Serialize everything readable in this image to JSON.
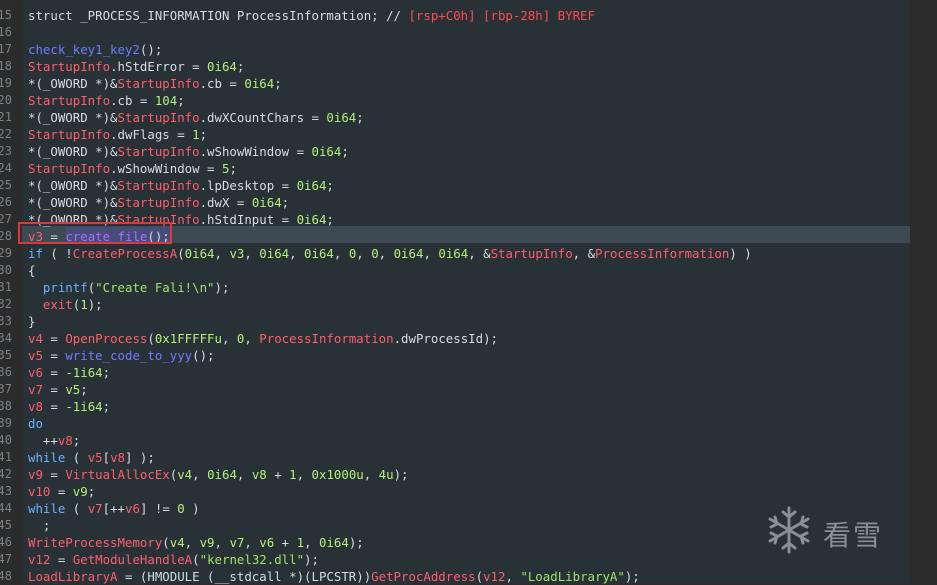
{
  "editor": {
    "lines": [
      {
        "n": "15",
        "tokens": [
          {
            "t": "struct _PROCESS_INFORMATION ProcessInformation; // ",
            "c": "plain"
          },
          {
            "t": "[rsp+C0h] [rbp-28h] BYREF",
            "c": "cmt"
          }
        ]
      },
      {
        "n": "16",
        "tokens": []
      },
      {
        "n": "17",
        "tokens": [
          {
            "t": "check_key1_key2",
            "c": "call"
          },
          {
            "t": "();",
            "c": "plain"
          }
        ]
      },
      {
        "n": "18",
        "tokens": [
          {
            "t": "StartupInfo",
            "c": "var"
          },
          {
            "t": ".hStdError = ",
            "c": "plain"
          },
          {
            "t": "0i64",
            "c": "num"
          },
          {
            "t": ";",
            "c": "plain"
          }
        ]
      },
      {
        "n": "19",
        "tokens": [
          {
            "t": "*(_OWORD *)&",
            "c": "plain"
          },
          {
            "t": "StartupInfo",
            "c": "var"
          },
          {
            "t": ".cb = ",
            "c": "plain"
          },
          {
            "t": "0i64",
            "c": "num"
          },
          {
            "t": ";",
            "c": "plain"
          }
        ]
      },
      {
        "n": "20",
        "tokens": [
          {
            "t": "StartupInfo",
            "c": "var"
          },
          {
            "t": ".cb = ",
            "c": "plain"
          },
          {
            "t": "104",
            "c": "num"
          },
          {
            "t": ";",
            "c": "plain"
          }
        ]
      },
      {
        "n": "21",
        "tokens": [
          {
            "t": "*(_OWORD *)&",
            "c": "plain"
          },
          {
            "t": "StartupInfo",
            "c": "var"
          },
          {
            "t": ".dwXCountChars = ",
            "c": "plain"
          },
          {
            "t": "0i64",
            "c": "num"
          },
          {
            "t": ";",
            "c": "plain"
          }
        ]
      },
      {
        "n": "22",
        "tokens": [
          {
            "t": "StartupInfo",
            "c": "var"
          },
          {
            "t": ".dwFlags = ",
            "c": "plain"
          },
          {
            "t": "1",
            "c": "num"
          },
          {
            "t": ";",
            "c": "plain"
          }
        ]
      },
      {
        "n": "23",
        "tokens": [
          {
            "t": "*(_OWORD *)&",
            "c": "plain"
          },
          {
            "t": "StartupInfo",
            "c": "var"
          },
          {
            "t": ".wShowWindow = ",
            "c": "plain"
          },
          {
            "t": "0i64",
            "c": "num"
          },
          {
            "t": ";",
            "c": "plain"
          }
        ]
      },
      {
        "n": "24",
        "tokens": [
          {
            "t": "StartupInfo",
            "c": "var"
          },
          {
            "t": ".wShowWindow = ",
            "c": "plain"
          },
          {
            "t": "5",
            "c": "num"
          },
          {
            "t": ";",
            "c": "plain"
          }
        ]
      },
      {
        "n": "25",
        "tokens": [
          {
            "t": "*(_OWORD *)&",
            "c": "plain"
          },
          {
            "t": "StartupInfo",
            "c": "var"
          },
          {
            "t": ".lpDesktop = ",
            "c": "plain"
          },
          {
            "t": "0i64",
            "c": "num"
          },
          {
            "t": ";",
            "c": "plain"
          }
        ]
      },
      {
        "n": "26",
        "tokens": [
          {
            "t": "*(_OWORD *)&",
            "c": "plain"
          },
          {
            "t": "StartupInfo",
            "c": "var"
          },
          {
            "t": ".dwX = ",
            "c": "plain"
          },
          {
            "t": "0i64",
            "c": "num"
          },
          {
            "t": ";",
            "c": "plain"
          }
        ]
      },
      {
        "n": "27",
        "tokens": [
          {
            "t": "*(_OWORD *)&",
            "c": "plain"
          },
          {
            "t": "StartupInfo",
            "c": "var"
          },
          {
            "t": ".hStdInput = ",
            "c": "plain"
          },
          {
            "t": "0i64",
            "c": "num"
          },
          {
            "t": ";",
            "c": "plain"
          }
        ]
      },
      {
        "n": "28",
        "tokens": [
          {
            "t": "v3",
            "c": "var"
          },
          {
            "t": " = ",
            "c": "plain"
          },
          {
            "t": "create_file",
            "c": "fn"
          },
          {
            "t": "();",
            "c": "plain"
          }
        ]
      },
      {
        "n": "29",
        "tokens": [
          {
            "t": "if",
            "c": "kw"
          },
          {
            "t": " ( !",
            "c": "plain"
          },
          {
            "t": "CreateProcessA",
            "c": "var"
          },
          {
            "t": "(",
            "c": "plain"
          },
          {
            "t": "0i64",
            "c": "num"
          },
          {
            "t": ", ",
            "c": "plain"
          },
          {
            "t": "v3",
            "c": "num"
          },
          {
            "t": ", ",
            "c": "plain"
          },
          {
            "t": "0i64",
            "c": "num"
          },
          {
            "t": ", ",
            "c": "plain"
          },
          {
            "t": "0i64",
            "c": "num"
          },
          {
            "t": ", ",
            "c": "plain"
          },
          {
            "t": "0",
            "c": "num"
          },
          {
            "t": ", ",
            "c": "plain"
          },
          {
            "t": "0",
            "c": "num"
          },
          {
            "t": ", ",
            "c": "plain"
          },
          {
            "t": "0i64",
            "c": "num"
          },
          {
            "t": ", ",
            "c": "plain"
          },
          {
            "t": "0i64",
            "c": "num"
          },
          {
            "t": ", &",
            "c": "plain"
          },
          {
            "t": "StartupInfo",
            "c": "var"
          },
          {
            "t": ", &",
            "c": "plain"
          },
          {
            "t": "ProcessInformation",
            "c": "var"
          },
          {
            "t": ") )",
            "c": "plain"
          }
        ]
      },
      {
        "n": "30",
        "tokens": [
          {
            "t": "{",
            "c": "plain"
          }
        ]
      },
      {
        "n": "31",
        "tokens": [
          {
            "t": "  ",
            "c": "plain"
          },
          {
            "t": "printf",
            "c": "kw"
          },
          {
            "t": "(",
            "c": "plain"
          },
          {
            "t": "\"Create Fali!\\n\"",
            "c": "str"
          },
          {
            "t": ");",
            "c": "plain"
          }
        ]
      },
      {
        "n": "32",
        "tokens": [
          {
            "t": "  ",
            "c": "plain"
          },
          {
            "t": "exit",
            "c": "var"
          },
          {
            "t": "(",
            "c": "plain"
          },
          {
            "t": "1",
            "c": "num"
          },
          {
            "t": ");",
            "c": "plain"
          }
        ]
      },
      {
        "n": "33",
        "tokens": [
          {
            "t": "}",
            "c": "plain"
          }
        ]
      },
      {
        "n": "34",
        "tokens": [
          {
            "t": "v4",
            "c": "var"
          },
          {
            "t": " = ",
            "c": "plain"
          },
          {
            "t": "OpenProcess",
            "c": "var"
          },
          {
            "t": "(",
            "c": "plain"
          },
          {
            "t": "0x1FFFFFu",
            "c": "num"
          },
          {
            "t": ", ",
            "c": "plain"
          },
          {
            "t": "0",
            "c": "num"
          },
          {
            "t": ", ",
            "c": "plain"
          },
          {
            "t": "ProcessInformation",
            "c": "var"
          },
          {
            "t": ".dwProcessId);",
            "c": "plain"
          }
        ]
      },
      {
        "n": "35",
        "tokens": [
          {
            "t": "v5",
            "c": "var"
          },
          {
            "t": " = ",
            "c": "plain"
          },
          {
            "t": "write_code_to_yyy",
            "c": "call"
          },
          {
            "t": "();",
            "c": "plain"
          }
        ]
      },
      {
        "n": "36",
        "tokens": [
          {
            "t": "v6",
            "c": "var"
          },
          {
            "t": " = ",
            "c": "plain"
          },
          {
            "t": "-1i64",
            "c": "num"
          },
          {
            "t": ";",
            "c": "plain"
          }
        ]
      },
      {
        "n": "37",
        "tokens": [
          {
            "t": "v7",
            "c": "var"
          },
          {
            "t": " = ",
            "c": "plain"
          },
          {
            "t": "v5",
            "c": "num"
          },
          {
            "t": ";",
            "c": "plain"
          }
        ]
      },
      {
        "n": "38",
        "tokens": [
          {
            "t": "v8",
            "c": "var"
          },
          {
            "t": " = ",
            "c": "plain"
          },
          {
            "t": "-1i64",
            "c": "num"
          },
          {
            "t": ";",
            "c": "plain"
          }
        ]
      },
      {
        "n": "39",
        "tokens": [
          {
            "t": "do",
            "c": "kw"
          }
        ]
      },
      {
        "n": "40",
        "tokens": [
          {
            "t": "  ++",
            "c": "plain"
          },
          {
            "t": "v8",
            "c": "var"
          },
          {
            "t": ";",
            "c": "plain"
          }
        ]
      },
      {
        "n": "41",
        "tokens": [
          {
            "t": "while",
            "c": "kw"
          },
          {
            "t": " ( ",
            "c": "plain"
          },
          {
            "t": "v5",
            "c": "var"
          },
          {
            "t": "[",
            "c": "plain"
          },
          {
            "t": "v8",
            "c": "var"
          },
          {
            "t": "] );",
            "c": "plain"
          }
        ]
      },
      {
        "n": "42",
        "tokens": [
          {
            "t": "v9",
            "c": "var"
          },
          {
            "t": " = ",
            "c": "plain"
          },
          {
            "t": "VirtualAllocEx",
            "c": "var"
          },
          {
            "t": "(",
            "c": "plain"
          },
          {
            "t": "v4",
            "c": "num"
          },
          {
            "t": ", ",
            "c": "plain"
          },
          {
            "t": "0i64",
            "c": "num"
          },
          {
            "t": ", ",
            "c": "plain"
          },
          {
            "t": "v8",
            "c": "num"
          },
          {
            "t": " + ",
            "c": "plain"
          },
          {
            "t": "1",
            "c": "num"
          },
          {
            "t": ", ",
            "c": "plain"
          },
          {
            "t": "0x1000u",
            "c": "num"
          },
          {
            "t": ", ",
            "c": "plain"
          },
          {
            "t": "4u",
            "c": "num"
          },
          {
            "t": ");",
            "c": "plain"
          }
        ]
      },
      {
        "n": "43",
        "tokens": [
          {
            "t": "v10",
            "c": "var"
          },
          {
            "t": " = ",
            "c": "plain"
          },
          {
            "t": "v9",
            "c": "num"
          },
          {
            "t": ";",
            "c": "plain"
          }
        ]
      },
      {
        "n": "44",
        "tokens": [
          {
            "t": "while",
            "c": "kw"
          },
          {
            "t": " ( ",
            "c": "plain"
          },
          {
            "t": "v7",
            "c": "var"
          },
          {
            "t": "[++",
            "c": "plain"
          },
          {
            "t": "v6",
            "c": "var"
          },
          {
            "t": "] != ",
            "c": "plain"
          },
          {
            "t": "0",
            "c": "num"
          },
          {
            "t": " )",
            "c": "plain"
          }
        ]
      },
      {
        "n": "45",
        "tokens": [
          {
            "t": "  ;",
            "c": "plain"
          }
        ]
      },
      {
        "n": "46",
        "tokens": [
          {
            "t": "WriteProcessMemory",
            "c": "var"
          },
          {
            "t": "(",
            "c": "plain"
          },
          {
            "t": "v4",
            "c": "num"
          },
          {
            "t": ", ",
            "c": "plain"
          },
          {
            "t": "v9",
            "c": "num"
          },
          {
            "t": ", ",
            "c": "plain"
          },
          {
            "t": "v7",
            "c": "num"
          },
          {
            "t": ", ",
            "c": "plain"
          },
          {
            "t": "v6",
            "c": "num"
          },
          {
            "t": " + ",
            "c": "plain"
          },
          {
            "t": "1",
            "c": "num"
          },
          {
            "t": ", ",
            "c": "plain"
          },
          {
            "t": "0i64",
            "c": "num"
          },
          {
            "t": ");",
            "c": "plain"
          }
        ]
      },
      {
        "n": "47",
        "tokens": [
          {
            "t": "v12",
            "c": "var"
          },
          {
            "t": " = ",
            "c": "plain"
          },
          {
            "t": "GetModuleHandleA",
            "c": "var"
          },
          {
            "t": "(",
            "c": "plain"
          },
          {
            "t": "\"kernel32.dll\"",
            "c": "str"
          },
          {
            "t": ");",
            "c": "plain"
          }
        ]
      },
      {
        "n": "48",
        "tokens": [
          {
            "t": "LoadLibraryA",
            "c": "var"
          },
          {
            "t": " = (HMODULE (__stdcall *)(LPCSTR))",
            "c": "plain"
          },
          {
            "t": "GetProcAddress",
            "c": "var"
          },
          {
            "t": "(",
            "c": "plain"
          },
          {
            "t": "v12",
            "c": "var"
          },
          {
            "t": ", ",
            "c": "plain"
          },
          {
            "t": "\"LoadLibraryA\"",
            "c": "str"
          },
          {
            "t": ");",
            "c": "plain"
          }
        ]
      }
    ]
  },
  "watermark": {
    "text": "看雪",
    "icon": "snowflake-icon"
  }
}
